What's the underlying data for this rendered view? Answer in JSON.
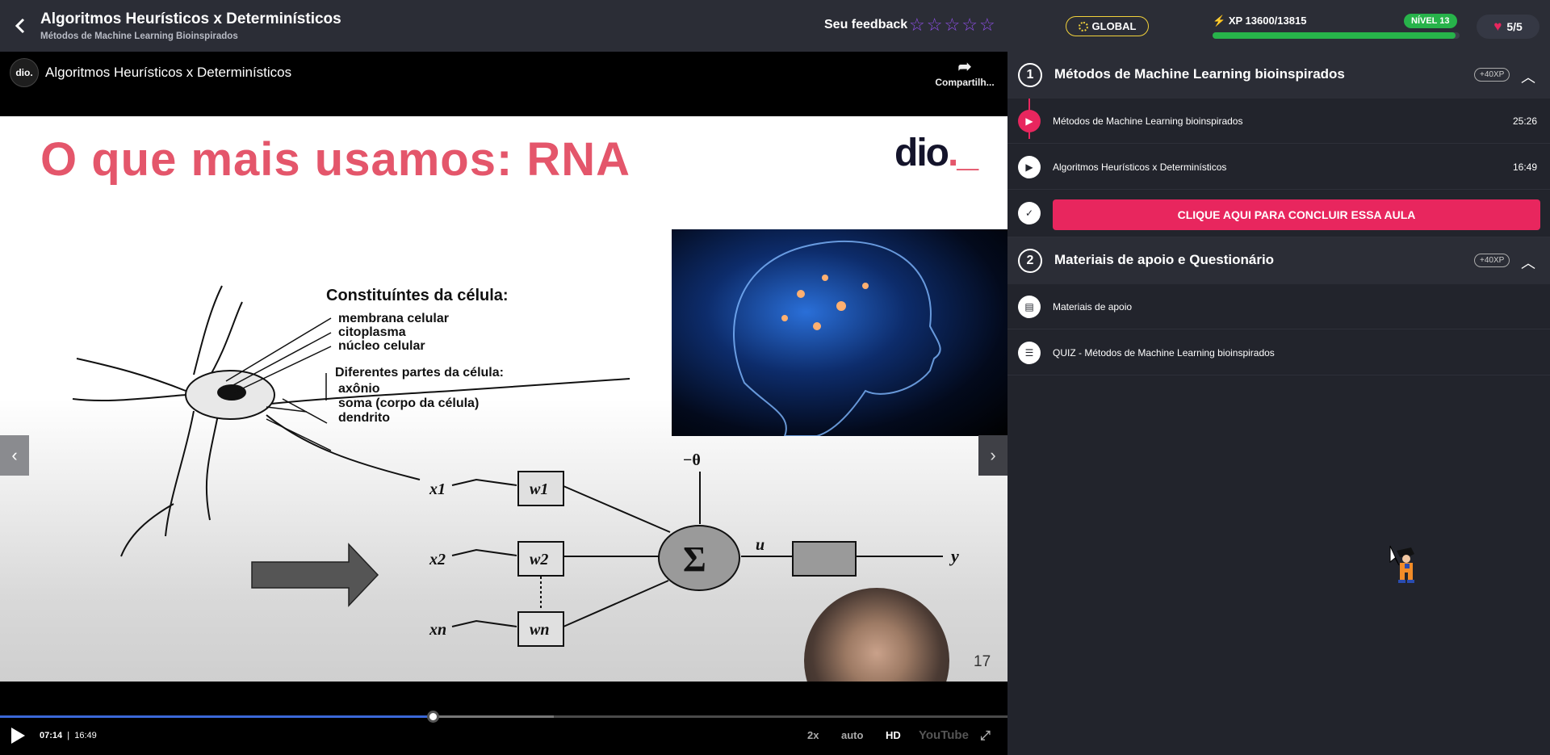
{
  "header": {
    "lesson_title": "Algoritmos Heurísticos x Determinísticos",
    "course_subtitle": "Métodos de Machine Learning Bioinspirados",
    "feedback_label": "Seu feedback",
    "stars": [
      "☆",
      "☆",
      "☆",
      "☆",
      "☆"
    ],
    "global_label": "GLOBAL",
    "xp_label": "XP 13600/13815",
    "xp_progress": 0.984,
    "level_label": "NÍVEL 13",
    "lives_label": "5/5",
    "accent_color": "#e8265e",
    "star_color": "#8e4fe6",
    "success_color": "#27b34a"
  },
  "player": {
    "channel_logo": "dio.",
    "video_title": "Algoritmos Heurísticos x Determinísticos",
    "share_label": "Compartilh...",
    "slide": {
      "title": "O que mais usamos: RNA",
      "logo": "dio._",
      "cell_heading": "Constituíntes da célula:",
      "cell_parts": [
        "membrana celular",
        "citoplasma",
        "núcleo celular"
      ],
      "cell_parts_heading": "Diferentes partes da célula:",
      "cell_parts_2": [
        "axônio",
        "soma (corpo da célula)",
        "dendrito"
      ],
      "neuron_inputs": [
        "x1",
        "x2",
        "xn"
      ],
      "neuron_weights": [
        "w1",
        "w2",
        "wn"
      ],
      "threshold": "−θ",
      "sum_symbol": "Σ",
      "u_label": "u",
      "y_label": "y",
      "page_number": "17"
    },
    "time_current": "07:14",
    "time_total": "16:49",
    "progress_played": 0.43,
    "speed_label": "2x",
    "quality_auto_label": "auto",
    "hd_label": "HD",
    "brand_label": "YouTube"
  },
  "sidebar": {
    "modules": [
      {
        "number": "1",
        "title": "Métodos de Machine Learning bioinspirados",
        "xp": "+40XP",
        "items": [
          {
            "label": "Métodos de Machine Learning bioinspirados",
            "time": "25:26",
            "icon": "play-icon"
          },
          {
            "label": "Algoritmos Heurísticos x Determinísticos",
            "time": "16:49",
            "icon": "play-icon"
          }
        ],
        "complete_label": "CLIQUE AQUI PARA CONCLUIR ESSA AULA"
      },
      {
        "number": "2",
        "title": "Materiais de apoio e Questionário",
        "xp": "+40XP",
        "items": [
          {
            "label": "Materiais de apoio",
            "icon": "document-icon"
          },
          {
            "label": "QUIZ - Métodos de Machine Learning bioinspirados",
            "icon": "list-icon"
          }
        ]
      }
    ]
  }
}
